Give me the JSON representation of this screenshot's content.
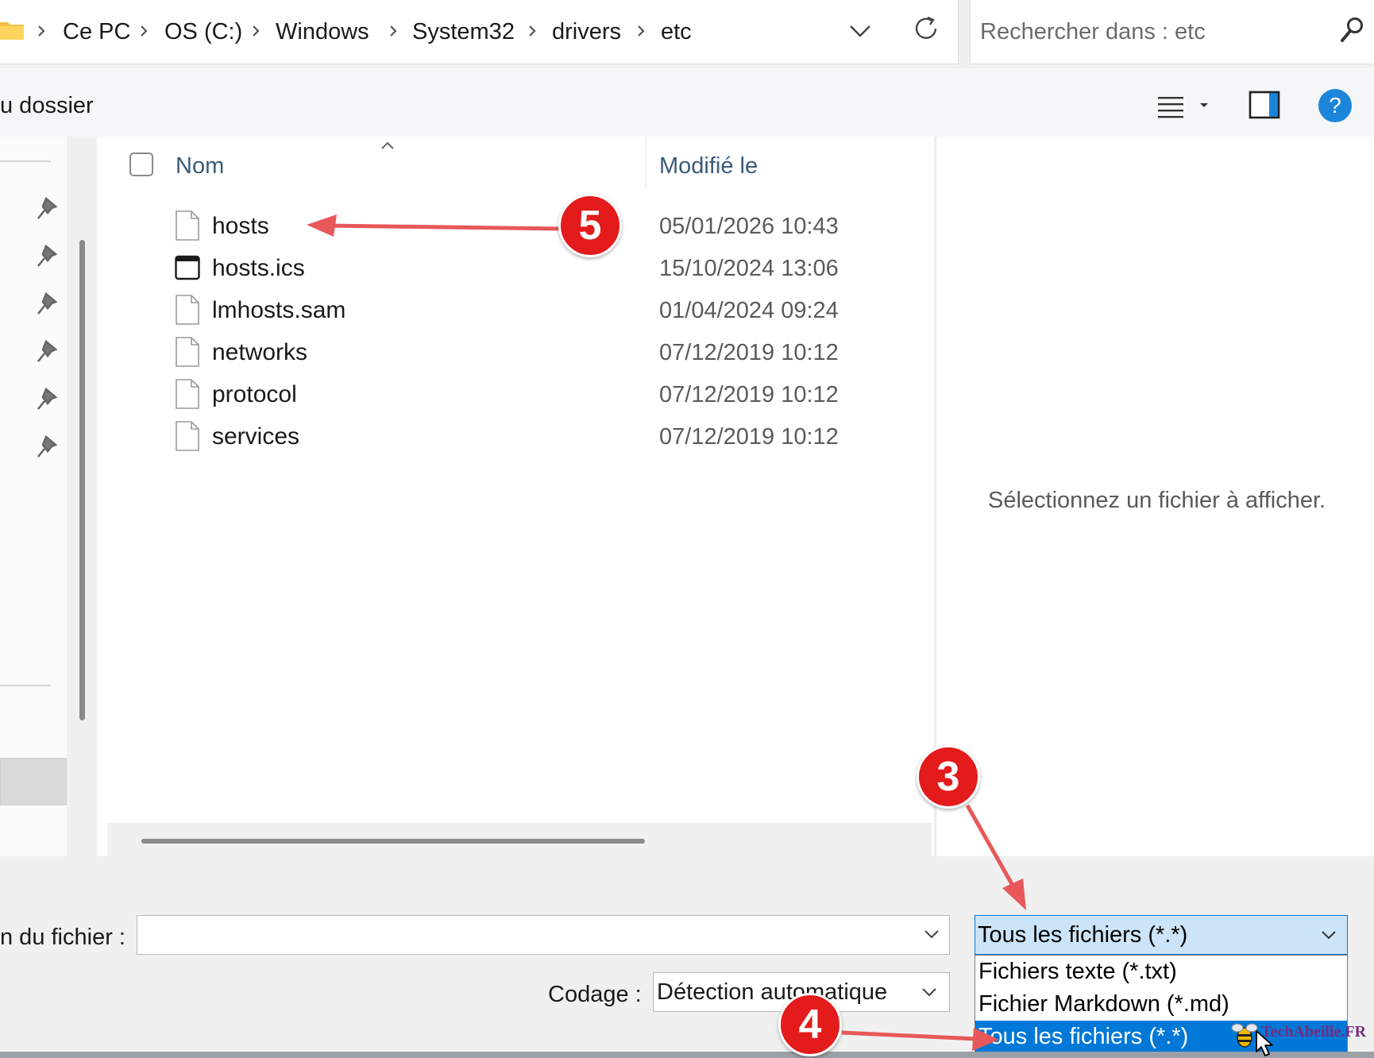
{
  "breadcrumb": {
    "items": [
      "Ce PC",
      "OS (C:)",
      "Windows",
      "System32",
      "drivers",
      "etc"
    ]
  },
  "search": {
    "placeholder": "Rechercher dans : etc"
  },
  "toolbar": {
    "new_folder_label": "u dossier",
    "help_label": "?"
  },
  "file_list": {
    "col_name": "Nom",
    "col_date": "Modifié le",
    "files": [
      {
        "name": "hosts",
        "date": "05/01/2026 10:43",
        "icon": "file-icon"
      },
      {
        "name": "hosts.ics",
        "date": "15/10/2024 13:06",
        "icon": "window-file-icon"
      },
      {
        "name": "lmhosts.sam",
        "date": "01/04/2024 09:24",
        "icon": "file-icon"
      },
      {
        "name": "networks",
        "date": "07/12/2019 10:12",
        "icon": "file-icon"
      },
      {
        "name": "protocol",
        "date": "07/12/2019 10:12",
        "icon": "file-icon"
      },
      {
        "name": "services",
        "date": "07/12/2019 10:12",
        "icon": "file-icon"
      }
    ]
  },
  "preview": {
    "message": "Sélectionnez un fichier à afficher."
  },
  "bottom": {
    "filename_label": "n du fichier :",
    "filename_value": "",
    "filetype_selected": "Tous les fichiers  (*.*)",
    "filetype_options": [
      "Fichiers texte (*.txt)",
      "Fichier Markdown (*.md)",
      "Tous les fichiers  (*.*)"
    ],
    "encoding_label": "Codage :",
    "encoding_value": "Détection automatique"
  },
  "annotations": {
    "badge_3": "3",
    "badge_4": "4",
    "badge_5": "5"
  },
  "watermark": {
    "text": "TechAbeille.FR"
  },
  "colors": {
    "accent": "#0078d7",
    "badge": "#e31b1b",
    "arrow": "#e8585a",
    "help": "#1b86d9"
  }
}
